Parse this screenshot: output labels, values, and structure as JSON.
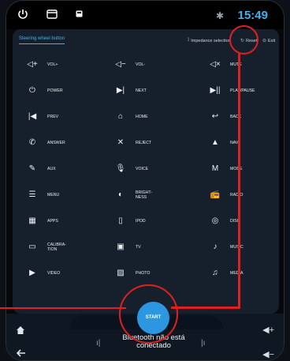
{
  "status": {
    "time": "15:49",
    "bluetooth_icon": "bluetooth-icon"
  },
  "header": {
    "tab": "Steering wheel button",
    "impedance": "Impedance selection",
    "reset": "Reset",
    "exit": "Exit"
  },
  "buttons": [
    {
      "label": "VOL+",
      "icon": "volume-up-icon",
      "glyph": "◁+"
    },
    {
      "label": "VOL-",
      "icon": "volume-down-icon",
      "glyph": "◁−"
    },
    {
      "label": "MUTE",
      "icon": "mute-icon",
      "glyph": "◁×"
    },
    {
      "label": "POWER",
      "icon": "power-icon",
      "glyph": "⏻"
    },
    {
      "label": "NEXT",
      "icon": "next-icon",
      "glyph": "▶|"
    },
    {
      "label": "PLAY/PAUSE",
      "icon": "play-pause-icon",
      "glyph": "▶||"
    },
    {
      "label": "PREV",
      "icon": "prev-icon",
      "glyph": "|◀"
    },
    {
      "label": "HOME",
      "icon": "home-icon",
      "glyph": "⌂"
    },
    {
      "label": "BACK",
      "icon": "back-icon",
      "glyph": "↩"
    },
    {
      "label": "ANSWER",
      "icon": "answer-icon",
      "glyph": "✆"
    },
    {
      "label": "REJECT",
      "icon": "reject-icon",
      "glyph": "✕"
    },
    {
      "label": "NAVI",
      "icon": "navi-icon",
      "glyph": "▲"
    },
    {
      "label": "AUX",
      "icon": "aux-icon",
      "glyph": "✎"
    },
    {
      "label": "VOICE",
      "icon": "microphone-icon",
      "glyph": "🎙"
    },
    {
      "label": "MODE",
      "icon": "mode-icon",
      "glyph": "M"
    },
    {
      "label": "MENU",
      "icon": "menu-icon",
      "glyph": "☰"
    },
    {
      "label": "BRIGHT-\nNESS",
      "icon": "brightness-icon",
      "glyph": "◐"
    },
    {
      "label": "RADIO",
      "icon": "radio-icon",
      "glyph": "📻"
    },
    {
      "label": "APPS",
      "icon": "apps-icon",
      "glyph": "▦"
    },
    {
      "label": "IPOD",
      "icon": "ipod-icon",
      "glyph": "▯"
    },
    {
      "label": "DISC",
      "icon": "disc-icon",
      "glyph": "◎"
    },
    {
      "label": "CALIBRA-\nTION",
      "icon": "calibration-icon",
      "glyph": "▭"
    },
    {
      "label": "TV",
      "icon": "tv-icon",
      "glyph": "▣"
    },
    {
      "label": "MUSIC",
      "icon": "music-icon",
      "glyph": "♪"
    },
    {
      "label": "VIDEO",
      "icon": "video-icon",
      "glyph": "▶"
    },
    {
      "label": "PHOTO",
      "icon": "photo-icon",
      "glyph": "▨"
    },
    {
      "label": "MEDIA",
      "icon": "media-icon",
      "glyph": "♫"
    }
  ],
  "start_label": "START",
  "bluetooth_status": "Bluetooth não está conectado"
}
